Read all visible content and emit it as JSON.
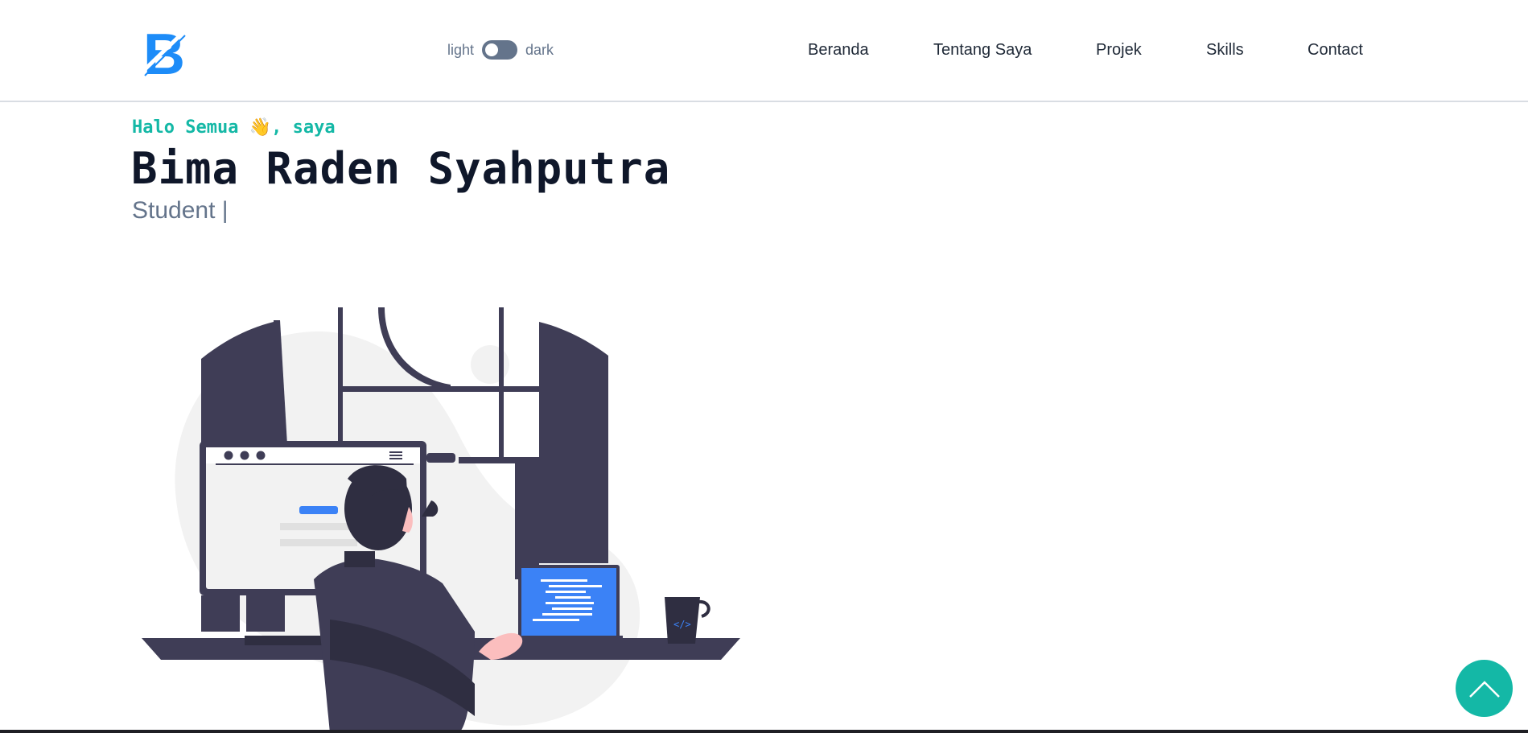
{
  "header": {
    "logo_letter": "B",
    "theme_toggle": {
      "light_label": "light",
      "dark_label": "dark",
      "state": "light"
    },
    "nav": [
      {
        "label": "Beranda"
      },
      {
        "label": "Tentang Saya"
      },
      {
        "label": "Projek"
      },
      {
        "label": "Skills"
      },
      {
        "label": "Contact"
      }
    ]
  },
  "hero": {
    "greeting": "Halo Semua 👋, saya",
    "name": "Bima Raden Syahputra",
    "role": "Student |"
  },
  "illustration": {
    "name": "developer-at-desk",
    "colors": {
      "dark": "#3f3d56",
      "screen_blue": "#3b82f6",
      "skin": "#f9b5b5",
      "blob": "#f2f2f2"
    }
  },
  "back_to_top": {
    "icon": "chevron-up-icon",
    "color": "#14b8a6"
  }
}
